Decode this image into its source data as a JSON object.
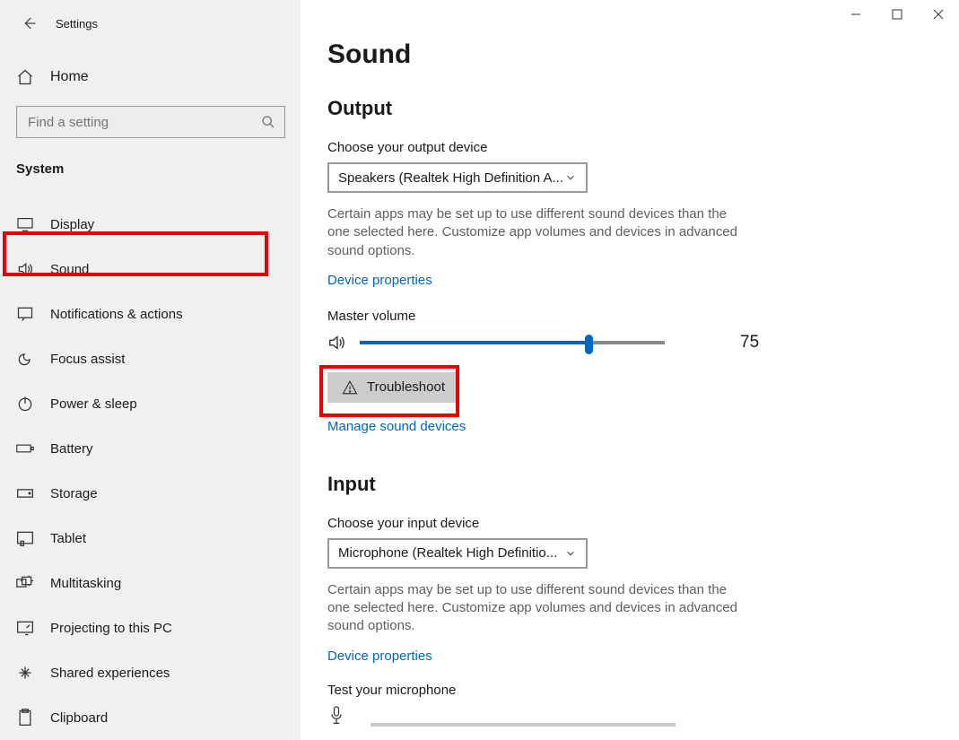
{
  "window": {
    "title": "Settings"
  },
  "sidebar": {
    "home": "Home",
    "search_placeholder": "Find a setting",
    "category": "System",
    "items": [
      {
        "label": "Display"
      },
      {
        "label": "Sound"
      },
      {
        "label": "Notifications & actions"
      },
      {
        "label": "Focus assist"
      },
      {
        "label": "Power & sleep"
      },
      {
        "label": "Battery"
      },
      {
        "label": "Storage"
      },
      {
        "label": "Tablet"
      },
      {
        "label": "Multitasking"
      },
      {
        "label": "Projecting to this PC"
      },
      {
        "label": "Shared experiences"
      },
      {
        "label": "Clipboard"
      }
    ]
  },
  "main": {
    "title": "Sound",
    "output": {
      "heading": "Output",
      "choose_label": "Choose your output device",
      "device_selected": "Speakers (Realtek High Definition A...",
      "description": "Certain apps may be set up to use different sound devices than the one selected here. Customize app volumes and devices in advanced sound options.",
      "device_props_link": "Device properties",
      "master_label": "Master volume",
      "volume_value": "75",
      "volume_percent": 75,
      "troubleshoot": "Troubleshoot",
      "manage_link": "Manage sound devices"
    },
    "input": {
      "heading": "Input",
      "choose_label": "Choose your input device",
      "device_selected": "Microphone (Realtek High Definitio...",
      "description": "Certain apps may be set up to use different sound devices than the one selected here. Customize app volumes and devices in advanced sound options.",
      "device_props_link": "Device properties",
      "test_label": "Test your microphone"
    }
  }
}
